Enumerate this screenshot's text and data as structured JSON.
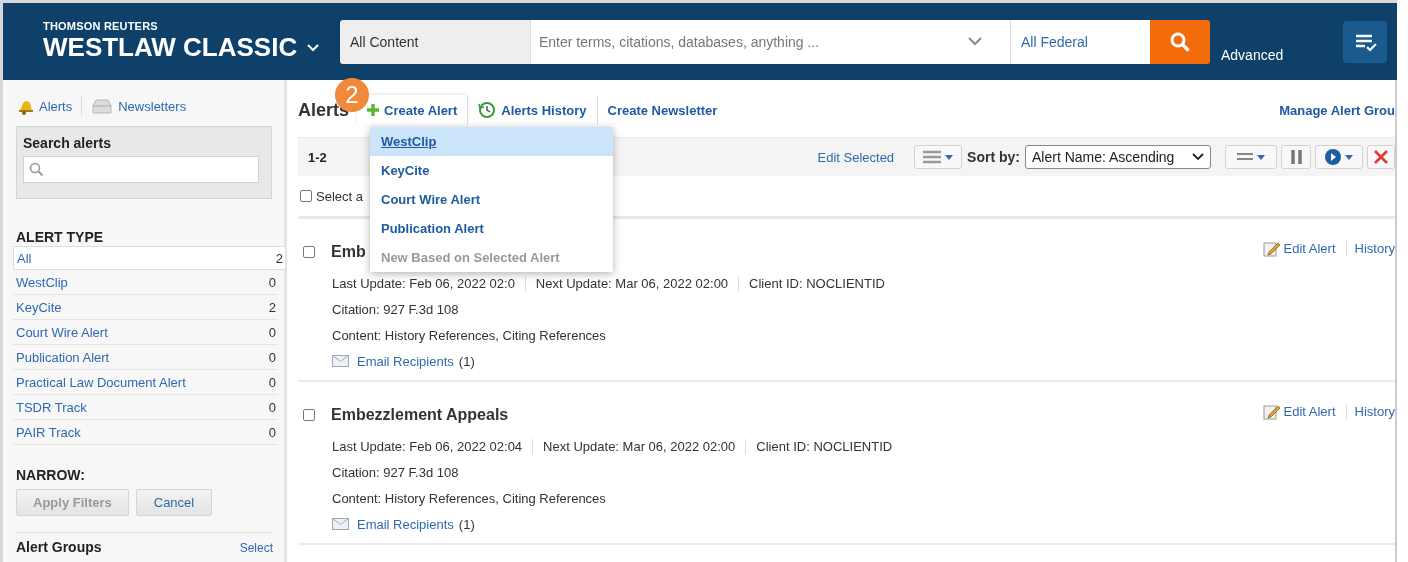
{
  "header": {
    "brand_top": "THOMSON REUTERS",
    "brand": "WESTLAW CLASSIC",
    "scope": "All Content",
    "search": {
      "placeholder": "Enter terms, citations, databases, anything ..."
    },
    "jurisdiction": "All Federal",
    "advanced": "Advanced"
  },
  "sidebar": {
    "tabs": [
      {
        "label": "Alerts",
        "kind": "bell"
      },
      {
        "label": "Newsletters",
        "kind": "tray"
      }
    ],
    "search": {
      "title": "Search alerts"
    },
    "alert_type": {
      "title": "ALERT TYPE",
      "items": [
        {
          "label": "All",
          "count": "2",
          "selected": true
        },
        {
          "label": "WestClip",
          "count": "0",
          "selected": false
        },
        {
          "label": "KeyCite",
          "count": "2",
          "selected": false
        },
        {
          "label": "Court Wire Alert",
          "count": "0",
          "selected": false
        },
        {
          "label": "Publication Alert",
          "count": "0",
          "selected": false
        },
        {
          "label": "Practical Law Document Alert",
          "count": "0",
          "selected": false
        },
        {
          "label": "TSDR Track",
          "count": "0",
          "selected": false
        },
        {
          "label": "PAIR Track",
          "count": "0",
          "selected": false
        }
      ]
    },
    "narrow": {
      "title": "NARROW:",
      "buttons": [
        {
          "label": "Apply Filters",
          "disabled": true
        },
        {
          "label": "Cancel",
          "disabled": false
        }
      ]
    },
    "groups": {
      "title": "Alert Groups",
      "action": "Select"
    }
  },
  "main": {
    "badge": "2",
    "title": "Alerts",
    "actions": [
      {
        "label": "Create Alert",
        "kind": "create",
        "expanded": true
      },
      {
        "label": "Alerts History",
        "kind": "history",
        "expanded": false
      },
      {
        "label": "Create Newsletter",
        "kind": "link",
        "expanded": false
      }
    ],
    "manage": "Manage Alert Grou",
    "toolbar": {
      "range": "1-2",
      "edit": "Edit Selected",
      "sort_label": "Sort by:",
      "sort_value": "Alert Name: Ascending"
    },
    "select_all": {
      "label": "Select a",
      "checked": false
    },
    "menu": [
      {
        "label": "WestClip",
        "selected": true,
        "disabled": false
      },
      {
        "label": "KeyCite",
        "selected": false,
        "disabled": false
      },
      {
        "label": "Court Wire Alert",
        "selected": false,
        "disabled": false
      },
      {
        "label": "Publication Alert",
        "selected": false,
        "disabled": false
      },
      {
        "label": "New Based on Selected Alert",
        "selected": false,
        "disabled": true
      }
    ],
    "alerts": [
      {
        "title": "Emb",
        "checked": false,
        "last_update": "Last Update: Feb 06, 2022 02:0",
        "next_update": "Next Update: Mar 06, 2022 02:00",
        "client_id": "Client ID: NOCLIENTID",
        "citation": "Citation: 927 F.3d 108",
        "content": "Content: History References, Citing References",
        "email_link": "Email Recipients",
        "email_count": "(1)",
        "edit": "Edit Alert",
        "history": "History"
      },
      {
        "title": "Embezzlement Appeals",
        "checked": false,
        "last_update": "Last Update: Feb 06, 2022 02:04",
        "next_update": "Next Update: Mar 06, 2022 02:00",
        "client_id": "Client ID: NOCLIENTID",
        "citation": "Citation: 927 F.3d 108",
        "content": "Content: History References, Citing References",
        "email_link": "Email Recipients",
        "email_count": "(1)",
        "edit": "Edit Alert",
        "history": "History"
      }
    ]
  }
}
